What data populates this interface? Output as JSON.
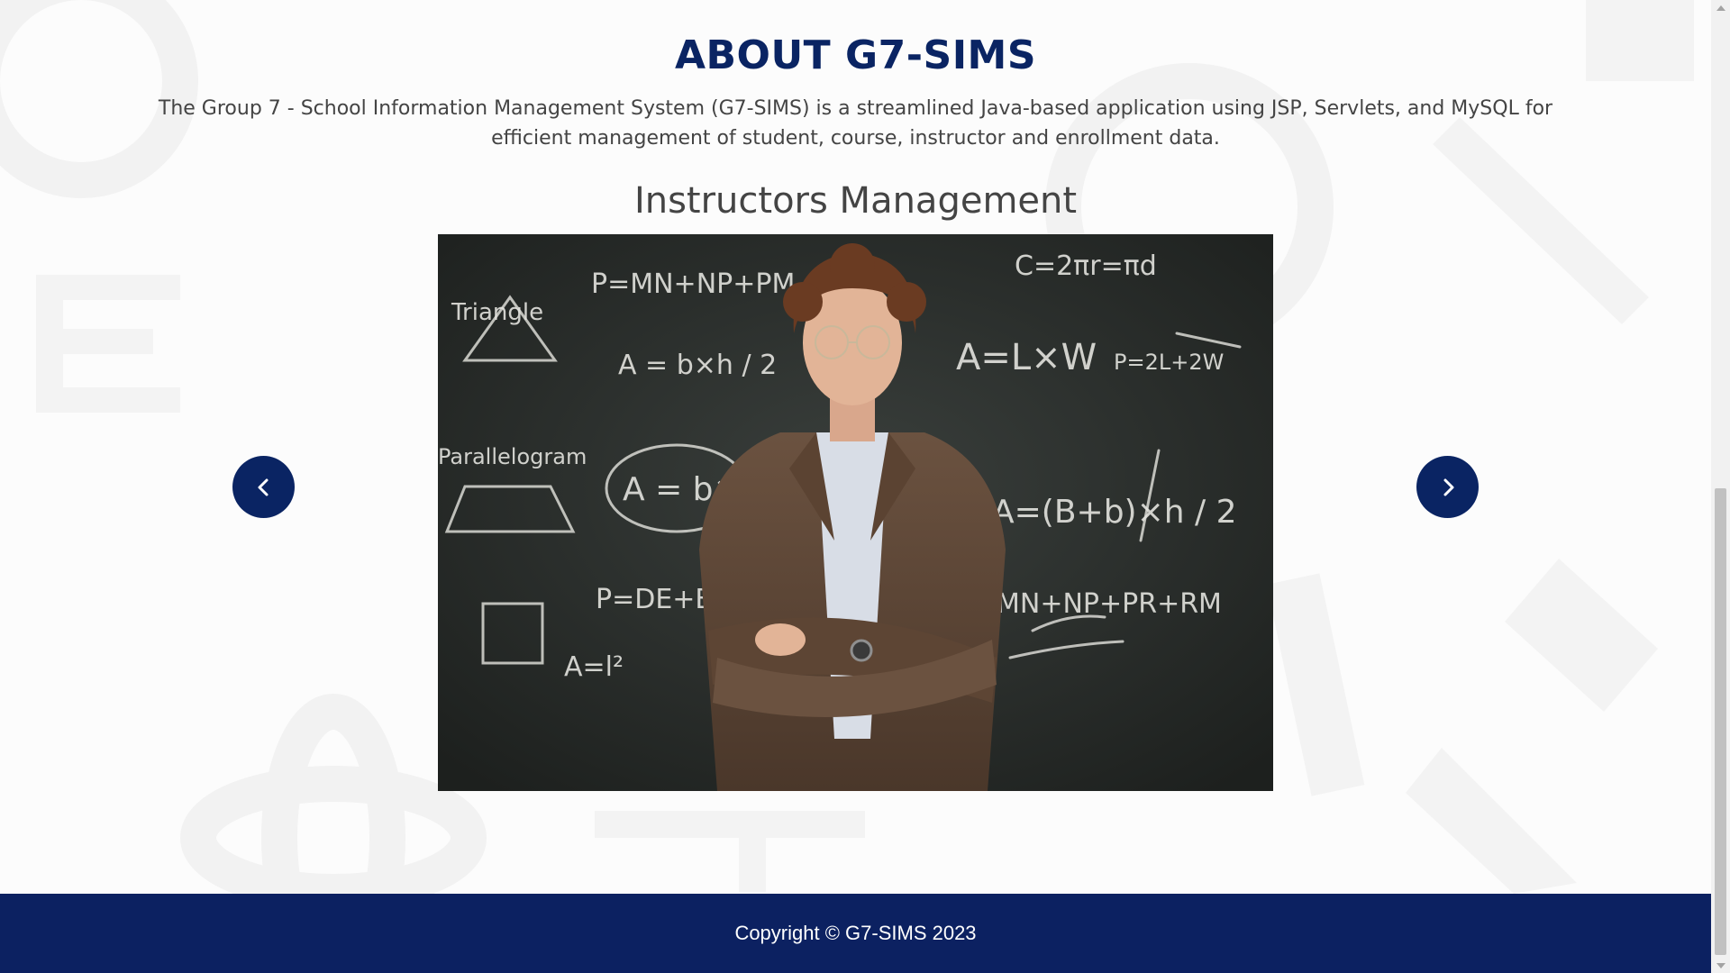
{
  "about": {
    "title": "ABOUT G7-SIMS",
    "description": "The Group 7 - School Information Management System (G7-SIMS) is a streamlined Java-based application using JSP, Servlets, and MySQL for efficient management of student, course, instructor and enrollment data."
  },
  "carousel": {
    "current_slide_title": "Instructors Management",
    "prev_icon": "chevron-left-icon",
    "next_icon": "chevron-right-icon"
  },
  "footer": {
    "copyright": "Copyright © G7-SIMS 2023"
  },
  "colors": {
    "brand_navy": "#0a2463",
    "footer_bg": "#0c2161",
    "text_gray": "#444444"
  }
}
